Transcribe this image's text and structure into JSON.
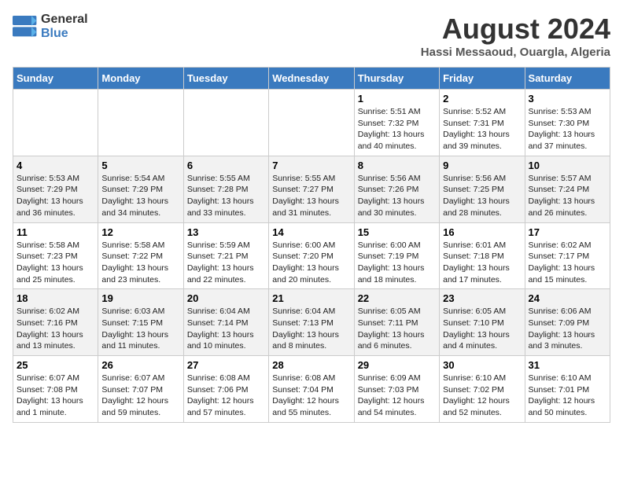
{
  "logo": {
    "line1": "General",
    "line2": "Blue"
  },
  "title": "August 2024",
  "subtitle": "Hassi Messaoud, Ouargla, Algeria",
  "days_header": [
    "Sunday",
    "Monday",
    "Tuesday",
    "Wednesday",
    "Thursday",
    "Friday",
    "Saturday"
  ],
  "weeks": [
    [
      {
        "day": "",
        "info": ""
      },
      {
        "day": "",
        "info": ""
      },
      {
        "day": "",
        "info": ""
      },
      {
        "day": "",
        "info": ""
      },
      {
        "day": "1",
        "info": "Sunrise: 5:51 AM\nSunset: 7:32 PM\nDaylight: 13 hours\nand 40 minutes."
      },
      {
        "day": "2",
        "info": "Sunrise: 5:52 AM\nSunset: 7:31 PM\nDaylight: 13 hours\nand 39 minutes."
      },
      {
        "day": "3",
        "info": "Sunrise: 5:53 AM\nSunset: 7:30 PM\nDaylight: 13 hours\nand 37 minutes."
      }
    ],
    [
      {
        "day": "4",
        "info": "Sunrise: 5:53 AM\nSunset: 7:29 PM\nDaylight: 13 hours\nand 36 minutes."
      },
      {
        "day": "5",
        "info": "Sunrise: 5:54 AM\nSunset: 7:29 PM\nDaylight: 13 hours\nand 34 minutes."
      },
      {
        "day": "6",
        "info": "Sunrise: 5:55 AM\nSunset: 7:28 PM\nDaylight: 13 hours\nand 33 minutes."
      },
      {
        "day": "7",
        "info": "Sunrise: 5:55 AM\nSunset: 7:27 PM\nDaylight: 13 hours\nand 31 minutes."
      },
      {
        "day": "8",
        "info": "Sunrise: 5:56 AM\nSunset: 7:26 PM\nDaylight: 13 hours\nand 30 minutes."
      },
      {
        "day": "9",
        "info": "Sunrise: 5:56 AM\nSunset: 7:25 PM\nDaylight: 13 hours\nand 28 minutes."
      },
      {
        "day": "10",
        "info": "Sunrise: 5:57 AM\nSunset: 7:24 PM\nDaylight: 13 hours\nand 26 minutes."
      }
    ],
    [
      {
        "day": "11",
        "info": "Sunrise: 5:58 AM\nSunset: 7:23 PM\nDaylight: 13 hours\nand 25 minutes."
      },
      {
        "day": "12",
        "info": "Sunrise: 5:58 AM\nSunset: 7:22 PM\nDaylight: 13 hours\nand 23 minutes."
      },
      {
        "day": "13",
        "info": "Sunrise: 5:59 AM\nSunset: 7:21 PM\nDaylight: 13 hours\nand 22 minutes."
      },
      {
        "day": "14",
        "info": "Sunrise: 6:00 AM\nSunset: 7:20 PM\nDaylight: 13 hours\nand 20 minutes."
      },
      {
        "day": "15",
        "info": "Sunrise: 6:00 AM\nSunset: 7:19 PM\nDaylight: 13 hours\nand 18 minutes."
      },
      {
        "day": "16",
        "info": "Sunrise: 6:01 AM\nSunset: 7:18 PM\nDaylight: 13 hours\nand 17 minutes."
      },
      {
        "day": "17",
        "info": "Sunrise: 6:02 AM\nSunset: 7:17 PM\nDaylight: 13 hours\nand 15 minutes."
      }
    ],
    [
      {
        "day": "18",
        "info": "Sunrise: 6:02 AM\nSunset: 7:16 PM\nDaylight: 13 hours\nand 13 minutes."
      },
      {
        "day": "19",
        "info": "Sunrise: 6:03 AM\nSunset: 7:15 PM\nDaylight: 13 hours\nand 11 minutes."
      },
      {
        "day": "20",
        "info": "Sunrise: 6:04 AM\nSunset: 7:14 PM\nDaylight: 13 hours\nand 10 minutes."
      },
      {
        "day": "21",
        "info": "Sunrise: 6:04 AM\nSunset: 7:13 PM\nDaylight: 13 hours\nand 8 minutes."
      },
      {
        "day": "22",
        "info": "Sunrise: 6:05 AM\nSunset: 7:11 PM\nDaylight: 13 hours\nand 6 minutes."
      },
      {
        "day": "23",
        "info": "Sunrise: 6:05 AM\nSunset: 7:10 PM\nDaylight: 13 hours\nand 4 minutes."
      },
      {
        "day": "24",
        "info": "Sunrise: 6:06 AM\nSunset: 7:09 PM\nDaylight: 13 hours\nand 3 minutes."
      }
    ],
    [
      {
        "day": "25",
        "info": "Sunrise: 6:07 AM\nSunset: 7:08 PM\nDaylight: 13 hours\nand 1 minute."
      },
      {
        "day": "26",
        "info": "Sunrise: 6:07 AM\nSunset: 7:07 PM\nDaylight: 12 hours\nand 59 minutes."
      },
      {
        "day": "27",
        "info": "Sunrise: 6:08 AM\nSunset: 7:06 PM\nDaylight: 12 hours\nand 57 minutes."
      },
      {
        "day": "28",
        "info": "Sunrise: 6:08 AM\nSunset: 7:04 PM\nDaylight: 12 hours\nand 55 minutes."
      },
      {
        "day": "29",
        "info": "Sunrise: 6:09 AM\nSunset: 7:03 PM\nDaylight: 12 hours\nand 54 minutes."
      },
      {
        "day": "30",
        "info": "Sunrise: 6:10 AM\nSunset: 7:02 PM\nDaylight: 12 hours\nand 52 minutes."
      },
      {
        "day": "31",
        "info": "Sunrise: 6:10 AM\nSunset: 7:01 PM\nDaylight: 12 hours\nand 50 minutes."
      }
    ]
  ]
}
